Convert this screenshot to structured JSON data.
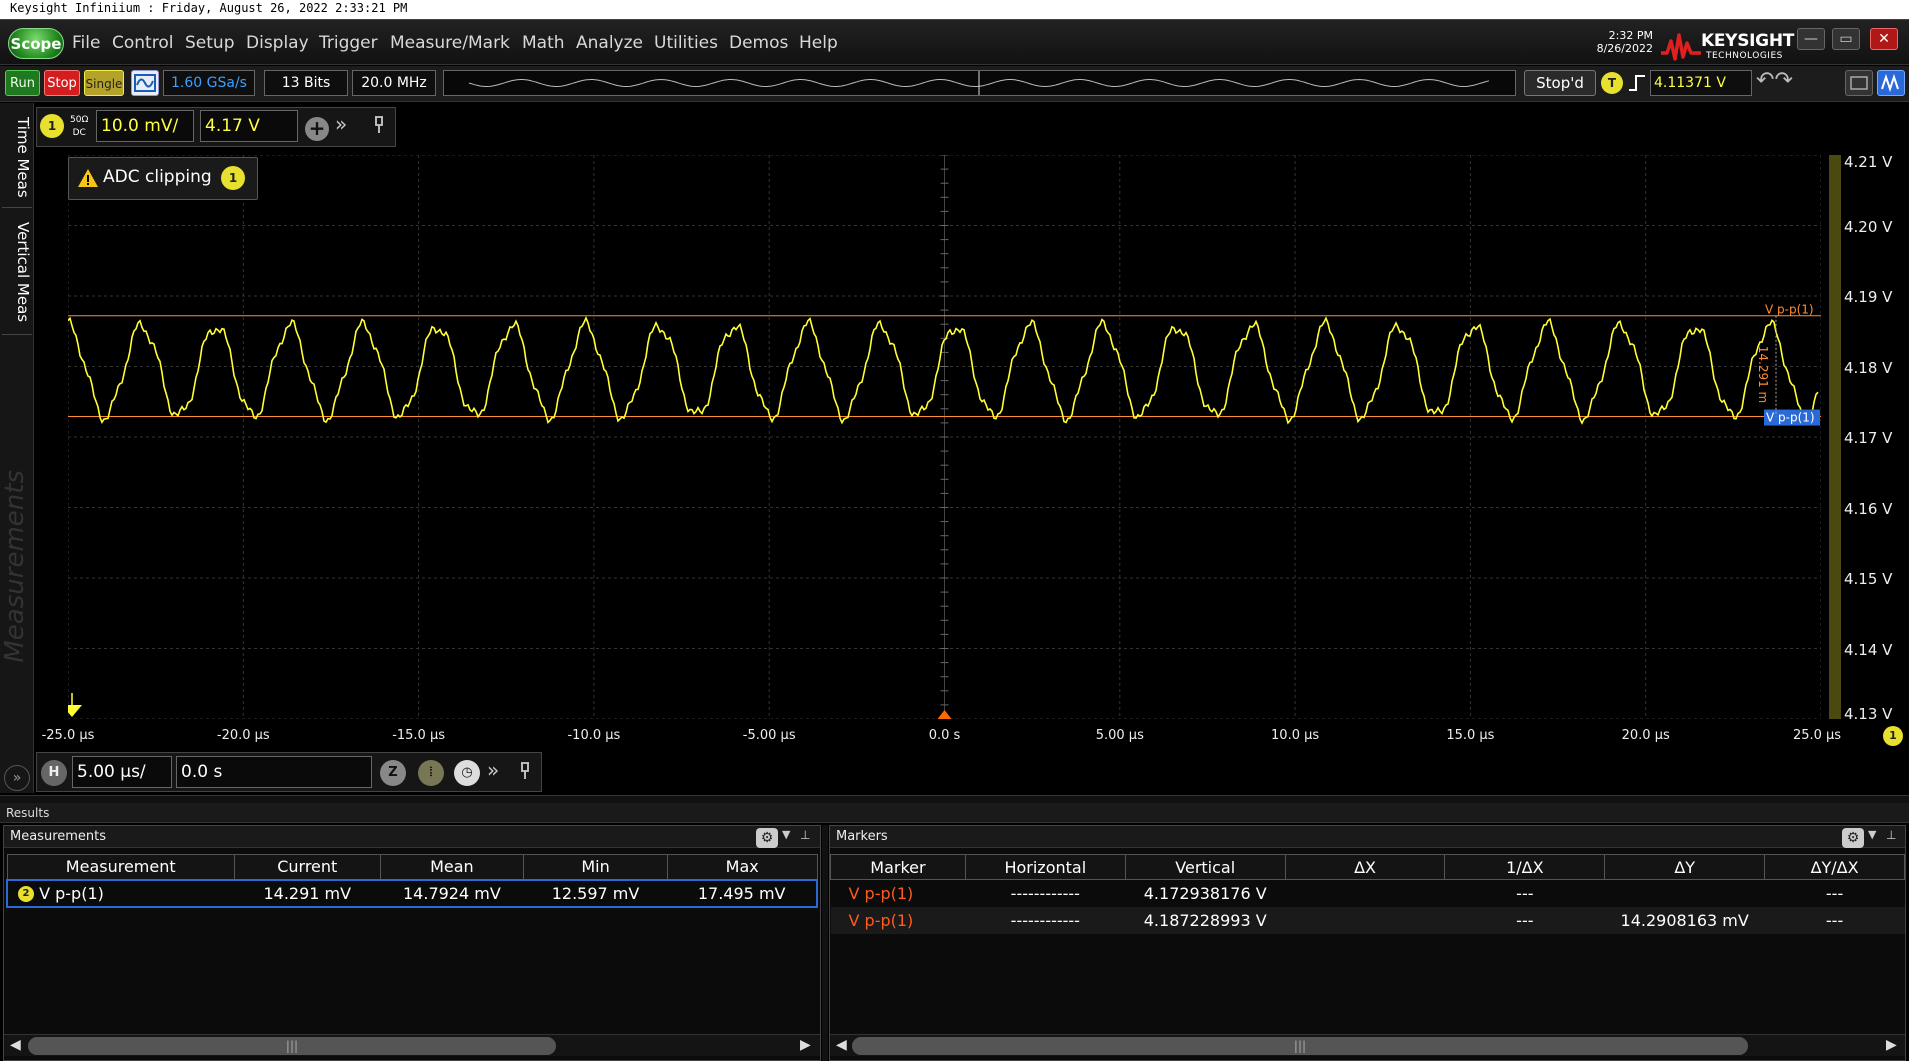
{
  "window": {
    "title": "Keysight Infiniium : Friday, August 26, 2022 2:33:21 PM"
  },
  "menubar": {
    "scope_label": "Scope",
    "items": [
      "File",
      "Control",
      "Setup",
      "Display",
      "Trigger",
      "Measure/Mark",
      "Math",
      "Analyze",
      "Utilities",
      "Demos",
      "Help"
    ],
    "clock_time": "2:32 PM",
    "clock_date": "8/26/2022",
    "brand": "KEYSIGHT",
    "brand_sub": "TECHNOLOGIES"
  },
  "toolbar": {
    "run_label": "Run",
    "stop_label": "Stop",
    "single_label": "Single",
    "sample_rate": "1.60 GSa/s",
    "bits": "13 Bits",
    "bandwidth": "20.0 MHz",
    "acq_status": "Stop'd",
    "trigger_badge": "T",
    "trigger_level": "4.11371 V"
  },
  "side_tabs": {
    "time_meas": "Time Meas",
    "vertical_meas": "Vertical Meas",
    "measurements": "Measurements"
  },
  "channel": {
    "number": "1",
    "impedance": "50Ω",
    "coupling": "DC",
    "scale": "10.0 mV/",
    "offset": "4.17 V"
  },
  "warning": {
    "text": "ADC clipping",
    "channel": "1"
  },
  "graticule": {
    "y_labels": [
      "4.21 V",
      "4.20 V",
      "4.19 V",
      "4.18 V",
      "4.17 V",
      "4.16 V",
      "4.15 V",
      "4.14 V",
      "4.13 V"
    ],
    "x_labels": [
      "-25.0 µs",
      "-20.0 µs",
      "-15.0 µs",
      "-10.0 µs",
      "-5.00 µs",
      "0.0 s",
      "5.00 µs",
      "10.0 µs",
      "15.0 µs",
      "20.0 µs",
      "25.0 µs"
    ],
    "marker_top_label": "V p-p(1)",
    "marker_bottom_label": "V p-p(1)",
    "marker_delta_label": "14.291 m",
    "ground_badge": "1",
    "right_badge": "1"
  },
  "horizontal": {
    "badge": "H",
    "scale": "5.00 µs/",
    "position": "0.0 s"
  },
  "results": {
    "title": "Results",
    "measurements": {
      "title": "Measurements",
      "columns": [
        "Measurement",
        "Current",
        "Mean",
        "Min",
        "Max"
      ],
      "rows": [
        {
          "badge": "2",
          "name": "V p-p(1)",
          "current": "14.291 mV",
          "mean": "14.7924 mV",
          "min": "12.597 mV",
          "max": "17.495 mV"
        }
      ]
    },
    "markers": {
      "title": "Markers",
      "columns": [
        "Marker",
        "Horizontal",
        "Vertical",
        "ΔX",
        "1/ΔX",
        "ΔY",
        "ΔY/ΔX"
      ],
      "rows": [
        {
          "marker": "V p-p(1)",
          "horizontal": "------------",
          "vertical": "4.172938176 V",
          "dx": "",
          "inv_dx": "---",
          "dy": "",
          "dy_dx": "---"
        },
        {
          "marker": "V p-p(1)",
          "horizontal": "------------",
          "vertical": "4.187228993 V",
          "dx": "",
          "inv_dx": "---",
          "dy": "14.2908163 mV",
          "dy_dx": "---"
        }
      ]
    }
  },
  "colors": {
    "trace": "#ffff33",
    "marker": "#ff8c30",
    "accent": "#2a6ad8"
  }
}
